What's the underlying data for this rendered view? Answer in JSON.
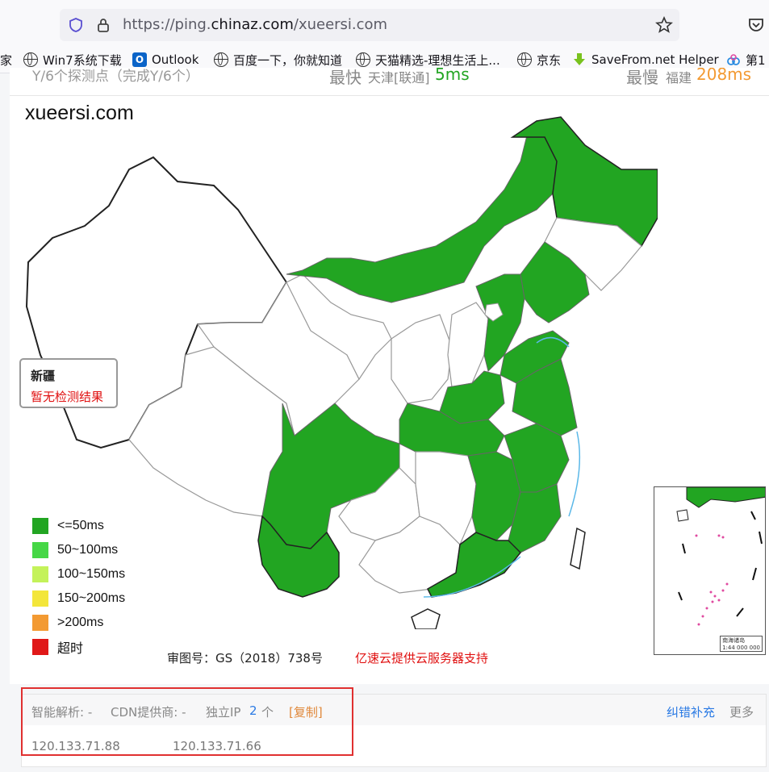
{
  "browser": {
    "url_prefix": "https://ping.",
    "url_host": "chinaz.com",
    "url_path": "/xueersi.com"
  },
  "bookmarks": [
    {
      "label": "家",
      "icon": "none"
    },
    {
      "label": "Win7系统下载",
      "icon": "globe-icon"
    },
    {
      "label": "Outlook",
      "icon": "outlook-icon"
    },
    {
      "label": "百度一下，你就知道",
      "icon": "globe-icon"
    },
    {
      "label": "天猫精选-理想生活上...",
      "icon": "globe-icon"
    },
    {
      "label": "京东",
      "icon": "globe-icon"
    },
    {
      "label": "SaveFrom.net Helper",
      "icon": "download-arrow-icon"
    },
    {
      "label": "第1",
      "icon": "cloud-icon"
    }
  ],
  "top_stats": {
    "left_partial": "Y/6个探测点（完成Y/6个）",
    "fast_label": "最快",
    "fast_sub": "天津[联通]",
    "fast_value": "5ms",
    "slow_label": "最慢",
    "slow_sub": "福建",
    "slow_value": "208ms"
  },
  "site_title": "xueersi.com",
  "tooltip": {
    "province": "新疆",
    "status": "暂无检测结果"
  },
  "legend": [
    {
      "label": "<=50ms",
      "color": "#22a522"
    },
    {
      "label": "50~100ms",
      "color": "#46d746"
    },
    {
      "label": "100~150ms",
      "color": "#c4f25a"
    },
    {
      "label": "150~200ms",
      "color": "#f3e63a"
    },
    {
      "label": ">200ms",
      "color": "#f39a32"
    },
    {
      "label": "超时",
      "color": "#e01818"
    }
  ],
  "map_note": "审图号：GS（2018）738号",
  "sponsor": "亿速云提供云服务器支持",
  "inset": {
    "title": "南海诸岛",
    "scale": "1:44 000 000"
  },
  "dns": {
    "smart_resolve": "智能解析: -",
    "cdn": "CDN提供商: -",
    "ip_label": "独立IP",
    "ip_count": "2",
    "ip_unit": "个",
    "copy": "[复制]",
    "report": "纠错补充",
    "more": "更多"
  },
  "ips": [
    "120.133.71.88",
    "120.133.71.66"
  ]
}
